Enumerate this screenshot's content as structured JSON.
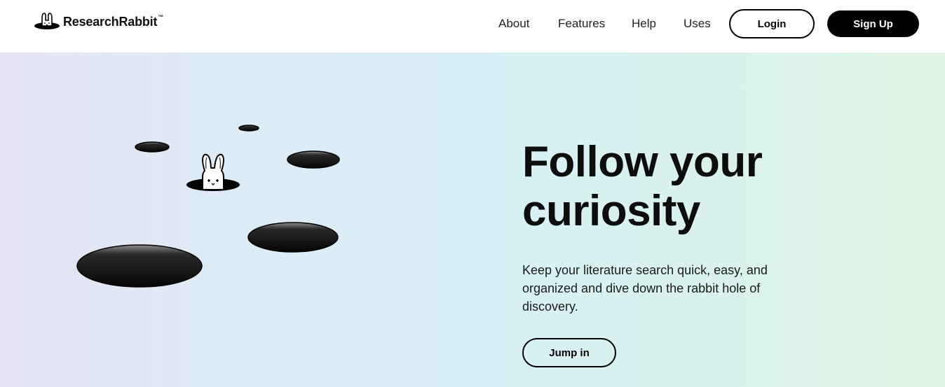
{
  "brand": {
    "name": "ResearchRabbit",
    "trademark": "™",
    "icon": "rabbit-in-hole-icon"
  },
  "nav": {
    "links": [
      {
        "label": "About"
      },
      {
        "label": "Features"
      },
      {
        "label": "Help"
      },
      {
        "label": "Uses"
      }
    ],
    "login_label": "Login",
    "signup_label": "Sign Up"
  },
  "hero": {
    "headline_line1": "Follow your",
    "headline_line2": "curiosity",
    "subtext": "Keep your literature search quick, easy, and organized and dive down the rabbit hole of discovery.",
    "cta_label": "Jump in",
    "illustration": "rabbit-holes-illustration"
  },
  "colors": {
    "text": "#000000",
    "button_dark": "#000000",
    "gradient_start": "#e5e4f4",
    "gradient_mid": "#d7f1f5",
    "gradient_end": "#def4e0"
  }
}
